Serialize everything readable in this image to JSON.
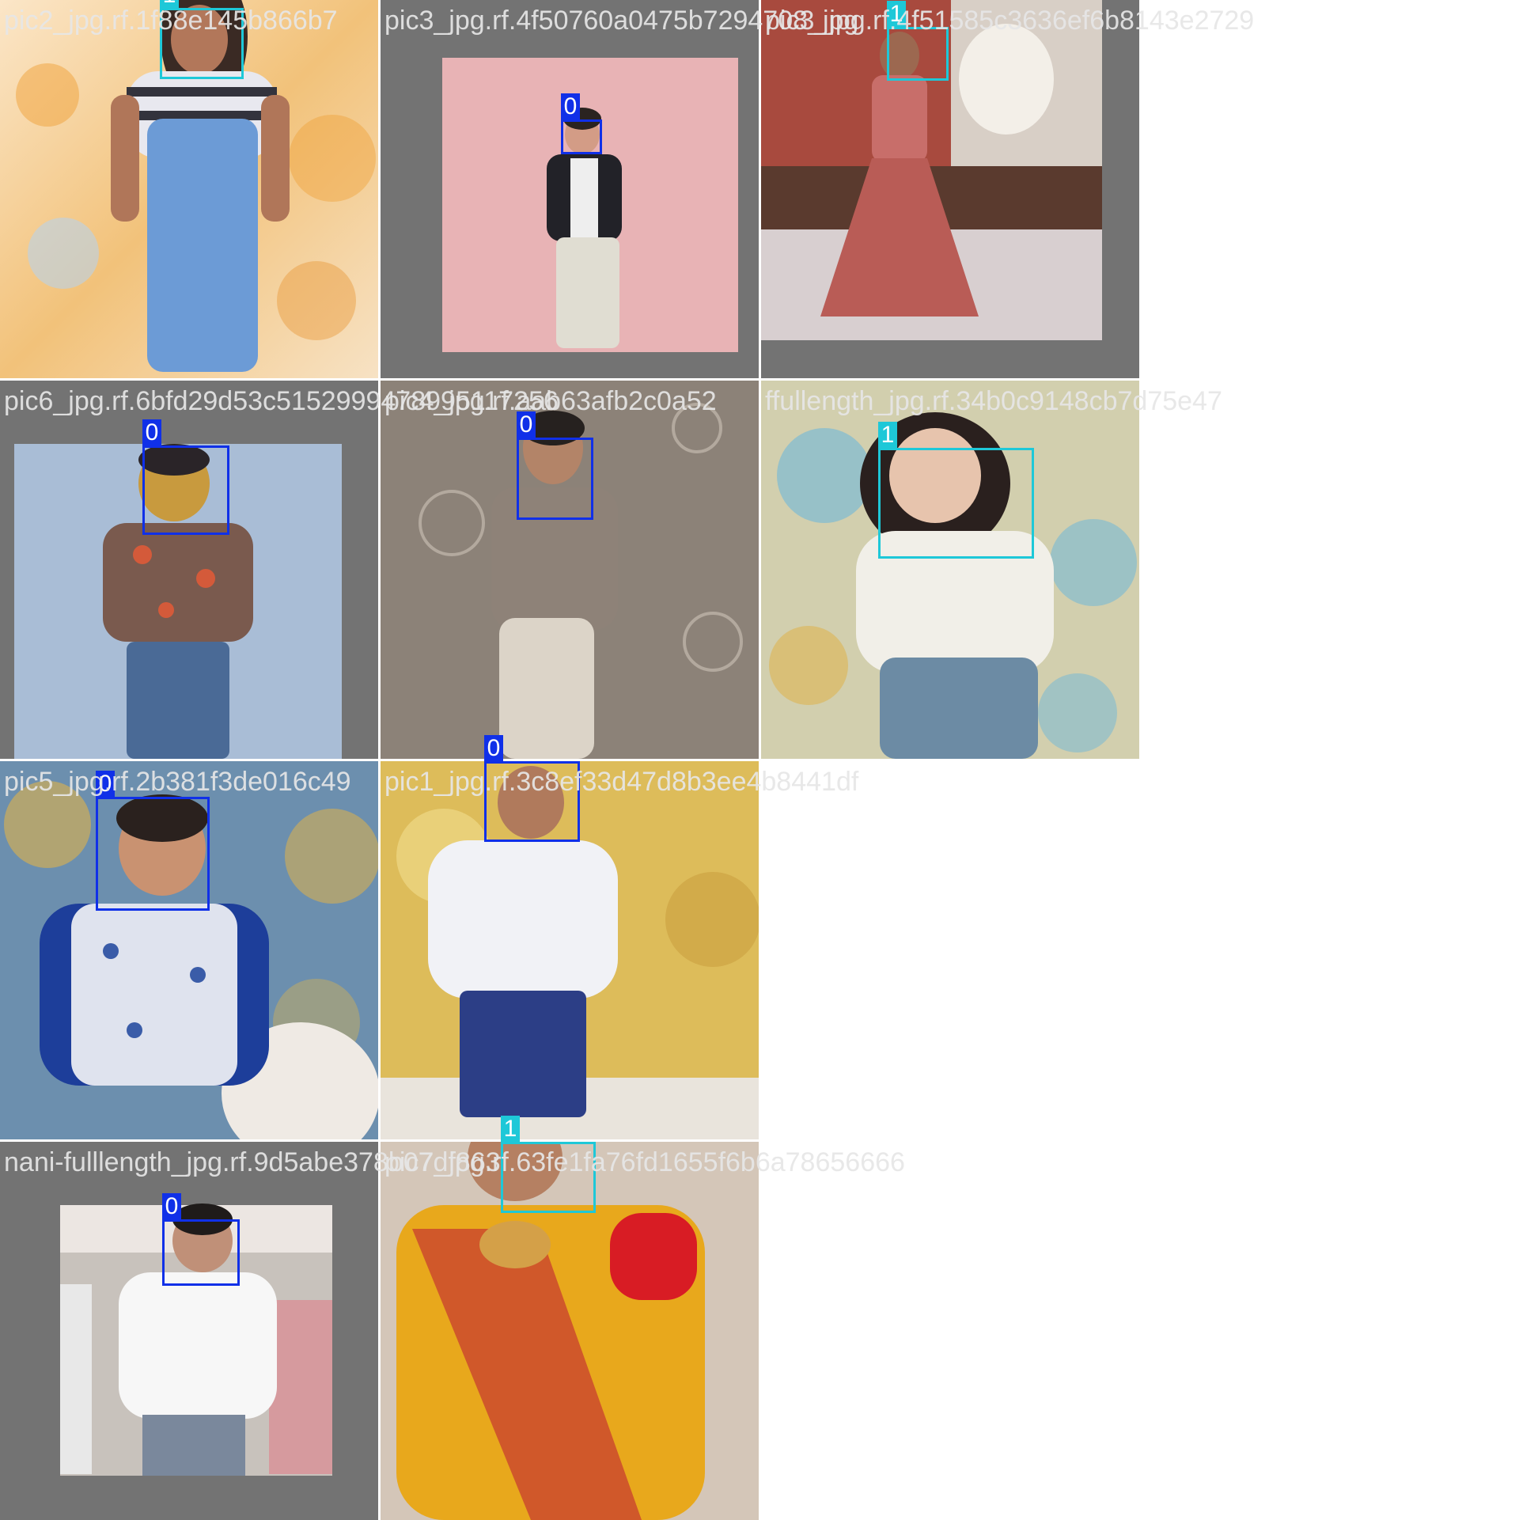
{
  "colors": {
    "class_0": "#1030e8",
    "class_1": "#1ec8d8",
    "pad": "#737373"
  },
  "tiles": [
    {
      "filename": "pic2_jpg.rf.1f88e145b866b7",
      "boxes": [
        {
          "label": "1",
          "cls": 1
        }
      ]
    },
    {
      "filename": "pic3_jpg.rf.4f50760a0475b7294708_jpg",
      "boxes": [
        {
          "label": "0",
          "cls": 0
        }
      ]
    },
    {
      "filename": "pic3_jpg.rf.4f51585c3636ef6b8143e2729",
      "boxes": [
        {
          "label": "1",
          "cls": 1
        }
      ]
    },
    {
      "filename": "pic6_jpg.rf.6bfd29d53c5152999478995117256",
      "boxes": [
        {
          "label": "0",
          "cls": 0
        }
      ]
    },
    {
      "filename": "pic4_jpg.rf.aab63afb2c0a52",
      "boxes": [
        {
          "label": "0",
          "cls": 0
        }
      ]
    },
    {
      "filename": "ffullength_jpg.rf.34b0c9148cb7d75e47",
      "boxes": [
        {
          "label": "1",
          "cls": 1
        }
      ]
    },
    {
      "filename": "pic5_jpg.rf.2b381f3de016c49",
      "boxes": [
        {
          "label": "0",
          "cls": 0
        }
      ]
    },
    {
      "filename": "pic1_jpg.rf.3c8ef33d47d8b3ee4b8441df",
      "boxes": [
        {
          "label": "0",
          "cls": 0
        }
      ]
    },
    {
      "filename": "nani-fulllength_jpg.rf.9d5abe378b07df863",
      "boxes": [
        {
          "label": "0",
          "cls": 0
        }
      ]
    },
    {
      "filename": "pic7_jpg.rf.63fe1fa76fd1655f6b6a78656666",
      "boxes": [
        {
          "label": "1",
          "cls": 1
        }
      ]
    }
  ]
}
